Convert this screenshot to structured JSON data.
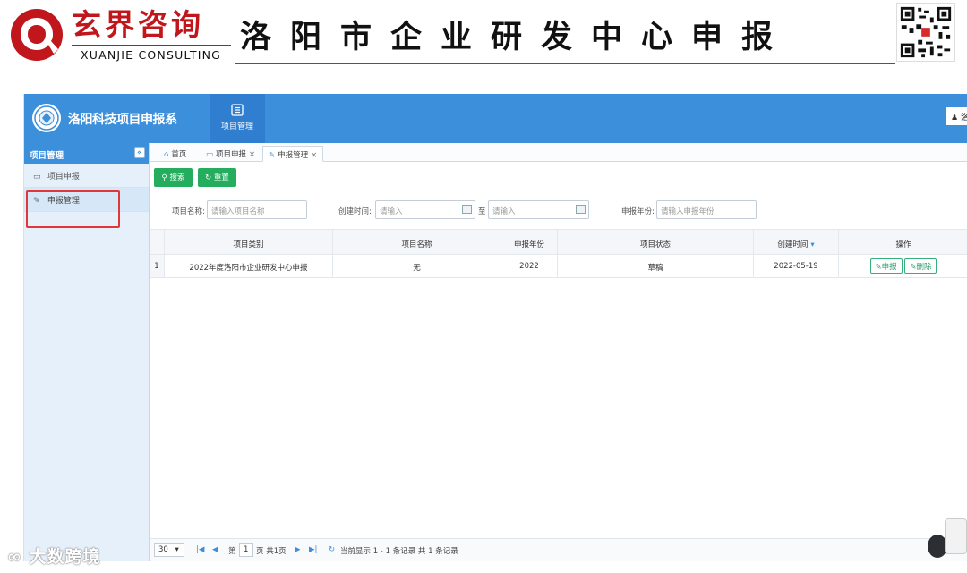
{
  "banner": {
    "brand_cn": "玄界咨询",
    "brand_en": "XUANJIE CONSULTING",
    "headline": "洛阳市企业研发中心申报"
  },
  "app": {
    "title": "洛阳科技项目申报系",
    "nav_module": "项目管理",
    "user_text": "洛"
  },
  "sidebar": {
    "heading": "项目管理",
    "collapse_glyph": "«",
    "items": [
      {
        "label": "项目申报",
        "icon": "laptop-icon"
      },
      {
        "label": "申报管理",
        "icon": "pencil-icon"
      }
    ]
  },
  "tabs": {
    "home": "首页",
    "t1": "项目申报",
    "t2": "申报管理",
    "close_glyph": "×"
  },
  "toolbar": {
    "search_label": "搜索",
    "reset_label": "重置"
  },
  "filters": {
    "name_label": "项目名称:",
    "name_placeholder": "请输入项目名称",
    "created_label": "创建时间:",
    "start_placeholder": "请输入",
    "to_label": "至",
    "end_placeholder": "请输入",
    "year_label": "申报年份:",
    "year_placeholder": "请输入申报年份"
  },
  "table": {
    "columns": [
      "项目类别",
      "项目名称",
      "申报年份",
      "项目状态",
      "创建时间",
      "操作"
    ],
    "rows": [
      {
        "index": "1",
        "category": "2022年度洛阳市企业研发中心申报",
        "name": "无",
        "year": "2022",
        "status": "草稿",
        "created": "2022-05-19",
        "actions": [
          "申报",
          "删除"
        ]
      }
    ]
  },
  "pager": {
    "page_size": "30",
    "page_label_pre": "第",
    "current_page": "1",
    "page_label_post": "页 共1页",
    "summary": "当前显示 1 - 1 条记录 共 1 条记录"
  },
  "watermark": "大数跨境",
  "colors": {
    "brand_red": "#c0161c",
    "header_blue": "#3c8fdb",
    "button_green": "#23ad5c",
    "highlight_red": "#e0373b"
  }
}
